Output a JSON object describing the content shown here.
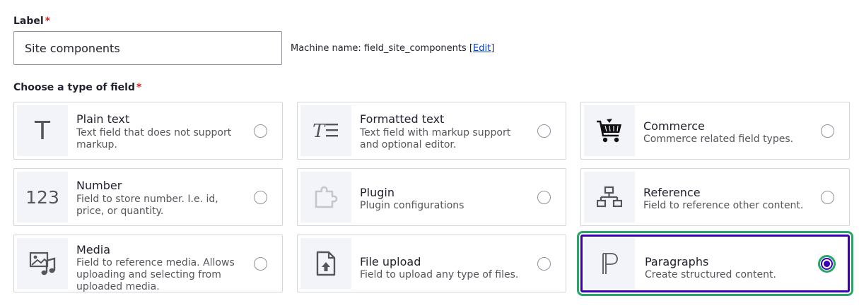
{
  "label_field": {
    "label": "Label",
    "required_mark": "*",
    "value": "Site components",
    "machine_name_prefix": "Machine name: field_site_components",
    "bracket_open": "[",
    "edit_link": "Edit",
    "bracket_close": "]"
  },
  "field_type": {
    "label": "Choose a type of field",
    "required_mark": "*",
    "options": [
      {
        "title": "Plain text",
        "description": "Text field that does not support markup.",
        "icon": "text-t-icon",
        "selected": false
      },
      {
        "title": "Formatted text",
        "description": "Text field with markup support and optional editor.",
        "icon": "formatted-text-icon",
        "selected": false
      },
      {
        "title": "Commerce",
        "description": "Commerce related field types.",
        "icon": "shopping-cart-icon",
        "selected": false
      },
      {
        "title": "Number",
        "description": "Field to store number. I.e. id, price, or quantity.",
        "icon": "number-123-icon",
        "selected": false
      },
      {
        "title": "Plugin",
        "description": "Plugin configurations",
        "icon": "puzzle-piece-icon",
        "selected": false
      },
      {
        "title": "Reference",
        "description": "Field to reference other content.",
        "icon": "hierarchy-icon",
        "selected": false
      },
      {
        "title": "Media",
        "description": "Field to reference media. Allows uploading and selecting from uploaded media.",
        "icon": "media-icon",
        "selected": false
      },
      {
        "title": "File upload",
        "description": "Field to upload any type of files.",
        "icon": "file-upload-icon",
        "selected": false
      },
      {
        "title": "Paragraphs",
        "description": "Create structured content.",
        "icon": "paragraph-icon",
        "selected": true
      }
    ]
  },
  "colors": {
    "accent": "#3b00b3",
    "focus": "#26a769",
    "required": "#dc2323",
    "link": "#003ecc"
  }
}
